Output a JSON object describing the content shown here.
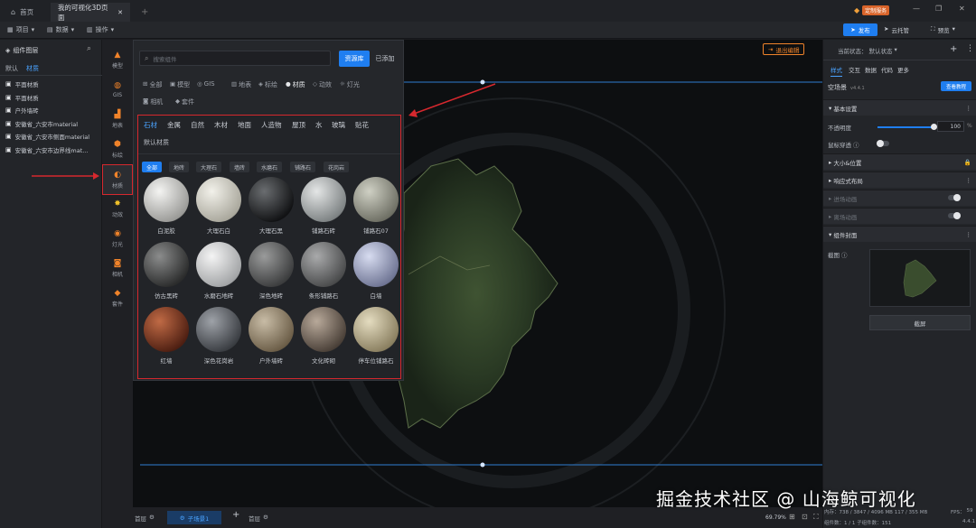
{
  "titlebar": {
    "home_tab": "首页",
    "doc_tab": "我的可视化3D页面",
    "close": "✕",
    "add": "+",
    "custom_service": "定制服务",
    "win_min": "—",
    "win_max": "❐",
    "win_close": "✕"
  },
  "menubar": {
    "items": [
      "项目",
      "数据",
      "操作"
    ],
    "publish": "发布",
    "cloud": "云托管",
    "preview": "预览"
  },
  "left": {
    "title": "组件图层",
    "tabs": [
      "默认",
      "材质"
    ],
    "items": [
      "平面材质",
      "平面材质",
      "户外墙砖",
      "安徽省_六安市material",
      "安徽省_六安市侧面material",
      "安徽省_六安市边界线mat..."
    ]
  },
  "iconbar": {
    "items": [
      "模型",
      "GIS",
      "地表",
      "标绘",
      "材质",
      "动效",
      "灯光",
      "相机",
      "套件"
    ]
  },
  "popup": {
    "search_placeholder": "搜索组件",
    "btn_library": "资源库",
    "btn_added": "已添加",
    "categories_row1": [
      "全部",
      "模型",
      "GIS",
      "地表",
      "标绘",
      "材质",
      "动效",
      "灯光"
    ],
    "categories_row2": [
      "相机",
      "套件"
    ],
    "material_tabs": [
      "石材",
      "金属",
      "自然",
      "木材",
      "地面",
      "人造物",
      "屋顶",
      "水",
      "玻璃",
      "贴花"
    ],
    "material_tab2": "默认材质",
    "sub_chips": [
      "全部",
      "地砖",
      "大理石",
      "墙砖",
      "水磨石",
      "铺路石",
      "花岗岩"
    ],
    "materials": [
      {
        "name": "白泥胶",
        "c1": "#f4f4f2",
        "c2": "#9a9a97"
      },
      {
        "name": "大理石白",
        "c1": "#f2f1ea",
        "c2": "#a9a79c"
      },
      {
        "name": "大理石黑",
        "c1": "#6a6d70",
        "c2": "#111214"
      },
      {
        "name": "铺路石砖",
        "c1": "#e4e6e6",
        "c2": "#7d8283"
      },
      {
        "name": "铺路石07",
        "c1": "#cfd0c4",
        "c2": "#6e6f64"
      },
      {
        "name": "仿古黑砖",
        "c1": "#8b8c8c",
        "c2": "#2b2c2c"
      },
      {
        "name": "水磨石地砖",
        "c1": "#f4f4f4",
        "c2": "#a2a4a6"
      },
      {
        "name": "深色地砖",
        "c1": "#9a9b9b",
        "c2": "#3c3d3e"
      },
      {
        "name": "条形铺路石",
        "c1": "#a9aaab",
        "c2": "#4a4b4c"
      },
      {
        "name": "白墙",
        "c1": "#d7dcf0",
        "c2": "#6f7594"
      },
      {
        "name": "红墙",
        "c1": "#c06a45",
        "c2": "#4e1f12"
      },
      {
        "name": "深色花岗岩",
        "c1": "#9ea2a8",
        "c2": "#3a3d42"
      },
      {
        "name": "户外墙砖",
        "c1": "#c8bca6",
        "c2": "#6b5d47"
      },
      {
        "name": "文化砖砌",
        "c1": "#b8a99a",
        "c2": "#4a4038"
      },
      {
        "name": "停车位铺路石",
        "c1": "#e4dcc0",
        "c2": "#8a7f60"
      }
    ]
  },
  "canvas": {
    "exit_edit": "退出编辑"
  },
  "right": {
    "status_label": "当前状态：",
    "status_value": "默认状态",
    "tabs": [
      "样式",
      "交互",
      "数据",
      "代码",
      "更多"
    ],
    "scene_name": "空场景",
    "version": "v4.4.1",
    "help_btn": "查看教程",
    "section_basic": "基本设置",
    "opacity_label": "不透明度",
    "opacity_value": "100",
    "opacity_unit": "%",
    "opacity_fraction": 1.0,
    "hover_label": "鼠标穿透",
    "section_size": "大小&位置",
    "section_responsive": "响应式布局",
    "section_tip1": "进场动画",
    "section_tip2": "离场动画",
    "section_cover": "组件封面",
    "screenshot_label": "截图",
    "screenshot_btn": "截屏"
  },
  "bottom": {
    "layer1": "首层",
    "current": "子场景1",
    "add": "+",
    "layer2": "首层",
    "zoom": "69.79%",
    "mem": "内存：738 / 3847 / 4096 MB  117 / 355 MB",
    "fps_label": "FPS：",
    "fps_value": "59",
    "count": "组件数：1 / 1   子组件数：151",
    "ver": "4.4.1"
  },
  "watermark": "掘金技术社区 @ 山海鲸可视化",
  "colors": {
    "accent": "#1f7ef0",
    "highlight_border": "#d6282e",
    "orange": "#f0832a"
  }
}
